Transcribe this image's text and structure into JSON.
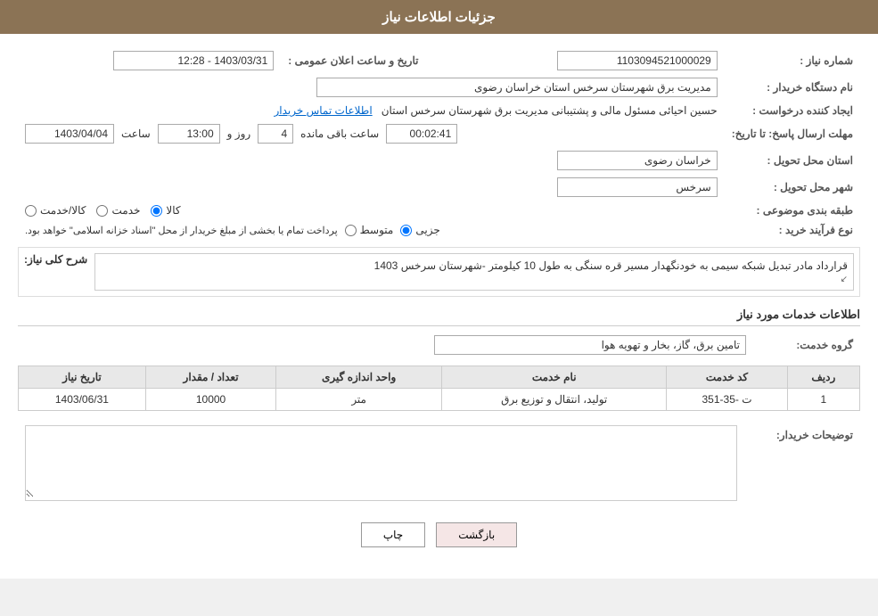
{
  "header": {
    "title": "جزئیات اطلاعات نیاز"
  },
  "fields": {
    "need_number_label": "شماره نیاز :",
    "need_number_value": "1103094521000029",
    "announce_datetime_label": "تاریخ و ساعت اعلان عمومی :",
    "announce_datetime_value": "1403/03/31 - 12:28",
    "buyer_org_label": "نام دستگاه خریدار :",
    "buyer_org_value": "مدیریت برق شهرستان سرخس استان خراسان رضوی",
    "creator_label": "ایجاد کننده درخواست :",
    "creator_value": "حسین احیائی مسئول مالی و پشتیبانی مدیریت برق شهرستان سرخس استان",
    "creator_link": "اطلاعات تماس خریدار",
    "response_deadline_label": "مهلت ارسال پاسخ: تا تاریخ:",
    "response_date": "1403/04/04",
    "response_time_label": "ساعت",
    "response_time": "13:00",
    "response_days_label": "روز و",
    "response_days": "4",
    "response_remaining_label": "ساعت باقی مانده",
    "response_remaining": "00:02:41",
    "province_label": "استان محل تحویل :",
    "province_value": "خراسان رضوی",
    "city_label": "شهر محل تحویل :",
    "city_value": "سرخس",
    "category_label": "طبقه بندی موضوعی :",
    "category_kala": "کالا",
    "category_khadamat": "خدمت",
    "category_kala_khadamat": "کالا/خدمت",
    "process_label": "نوع فرآیند خرید :",
    "process_jozi": "جزیی",
    "process_motavaset": "متوسط",
    "process_desc": "پرداخت تمام یا بخشی از مبلغ خریدار از محل \"اسناد خزانه اسلامی\" خواهد بود.",
    "needs_section_title": "شرح کلی نیاز:",
    "needs_text": "قرارداد مادر تبدیل شبکه سیمی به خودنگهدار مسیر قره سنگی به طول 10 کیلومتر -شهرستان سرخس 1403",
    "services_section_title": "اطلاعات خدمات مورد نیاز",
    "service_group_label": "گروه خدمت:",
    "service_group_value": "تامین برق، گاز، بخار و تهویه هوا",
    "table_headers": [
      "ردیف",
      "کد خدمت",
      "نام خدمت",
      "واحد اندازه گیری",
      "تعداد / مقدار",
      "تاریخ نیاز"
    ],
    "table_rows": [
      {
        "row": "1",
        "code": "ت -35-351",
        "name": "تولید، انتقال و توزیع برق",
        "unit": "متر",
        "quantity": "10000",
        "date": "1403/06/31"
      }
    ],
    "buyer_comments_label": "توضیحات خریدار:",
    "buyer_comments_value": "",
    "btn_print": "چاپ",
    "btn_back": "بازگشت"
  }
}
